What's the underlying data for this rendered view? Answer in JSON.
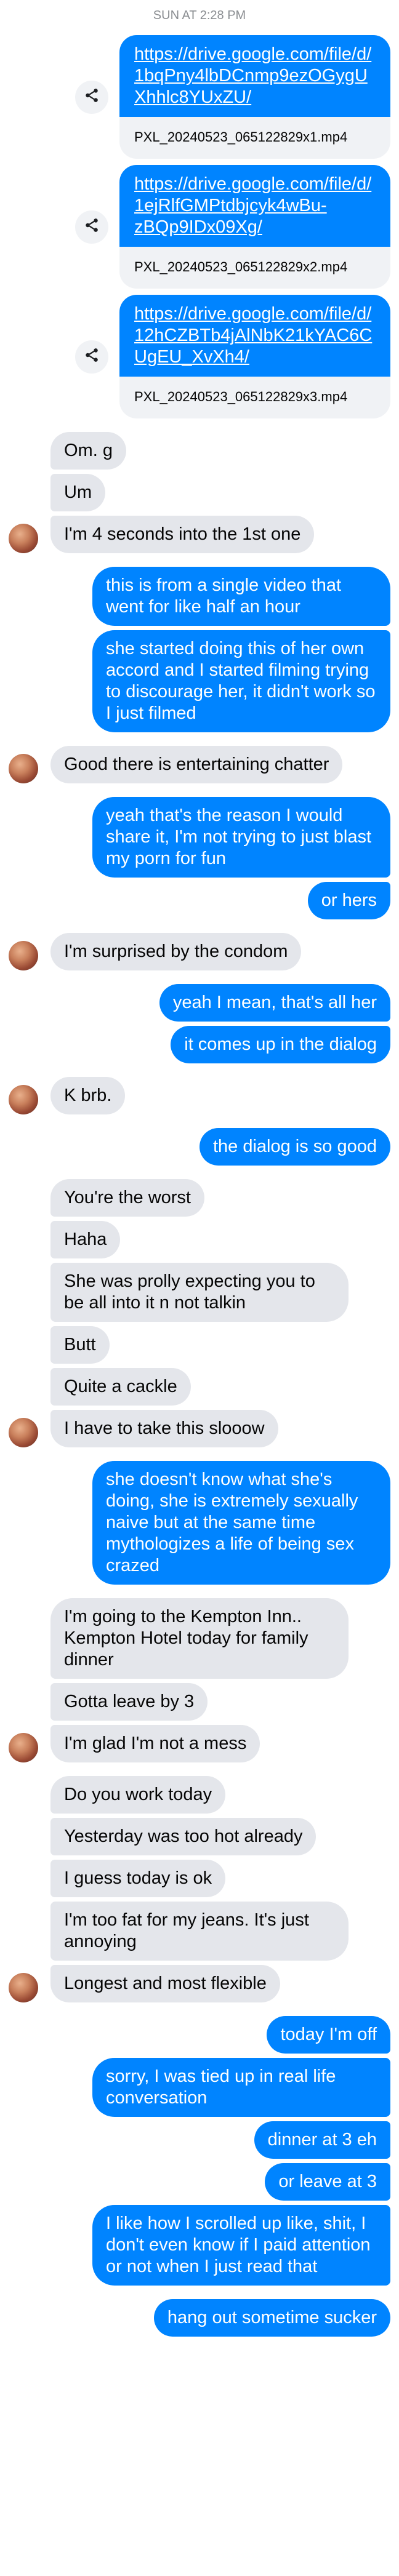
{
  "header": {
    "timestamp": "SUN AT 2:28 PM"
  },
  "links": [
    {
      "url": "https://drive.google.com/file/d/1bqPny4lbDCnmp9ezOGygUXhhlc8YUxZU/",
      "file": "PXL_20240523_065122829x1.mp4"
    },
    {
      "url": "https://drive.google.com/file/d/1ejRlfGMPtdbjcyk4wBu-zBQp9IDx09Xg/",
      "file": "PXL_20240523_065122829x2.mp4"
    },
    {
      "url": "https://drive.google.com/file/d/12hCZBTb4jAlNbK21kYAC6CUgEU_XvXh4/",
      "file": "PXL_20240523_065122829x3.mp4"
    }
  ],
  "icons": {
    "share": "share-icon",
    "avatar": "contact-avatar"
  },
  "colors": {
    "outgoing": "#0084ff",
    "incoming": "#e4e6eb",
    "link_card_footer": "#f0f2f5"
  },
  "messages": [
    {
      "text": "Om. g"
    },
    {
      "text": "Um"
    },
    {
      "text": "I'm 4 seconds into the 1st one"
    },
    {
      "text": "this is from a single video that went for like half an hour"
    },
    {
      "text": "she started doing this of her own accord and I started filming trying to discourage her, it didn't work so I just filmed"
    },
    {
      "text": "Good there is entertaining chatter"
    },
    {
      "text": "yeah that's the reason I would share it, I'm not trying to just blast my porn for fun"
    },
    {
      "text": "or hers"
    },
    {
      "text": "I'm surprised by the condom"
    },
    {
      "text": "yeah I mean, that's all her"
    },
    {
      "text": "it comes up in the dialog"
    },
    {
      "text": "K brb."
    },
    {
      "text": "the dialog is so good"
    },
    {
      "text": "You're the worst"
    },
    {
      "text": "Haha"
    },
    {
      "text": "She was prolly expecting you to be all into it n not talkin"
    },
    {
      "text": "Butt"
    },
    {
      "text": "Quite a cackle"
    },
    {
      "text": "I have to take this slooow"
    },
    {
      "text": "she doesn't know what she's doing, she is extremely sexually naive but at the same time mythologizes a life of being sex crazed"
    },
    {
      "text": "I'm going to the Kempton Inn.. Kempton Hotel today for family dinner"
    },
    {
      "text": "Gotta leave by 3"
    },
    {
      "text": "I'm glad I'm not a mess"
    },
    {
      "text": "Do you work today"
    },
    {
      "text": "Yesterday was too hot already"
    },
    {
      "text": "I guess today is ok"
    },
    {
      "text": "I'm too fat for my jeans. It's just annoying"
    },
    {
      "text": "Longest and most flexible"
    },
    {
      "text": "today I'm off"
    },
    {
      "text": "sorry, I was tied up in real life conversation"
    },
    {
      "text": "dinner at 3 eh"
    },
    {
      "text": "or leave at 3"
    },
    {
      "text": "I like how I scrolled up like, shit, I don't even know if I paid attention or not when I just read that"
    },
    {
      "text": "hang out sometime sucker"
    }
  ]
}
